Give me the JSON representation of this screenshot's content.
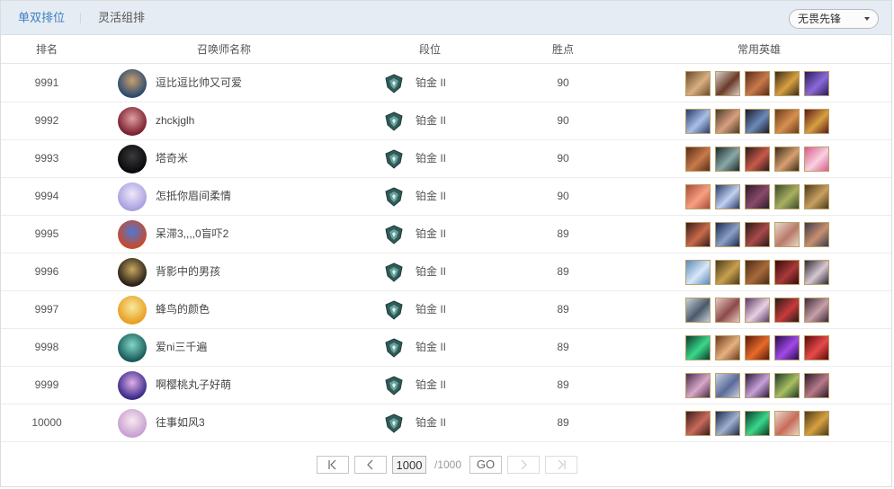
{
  "tabs": [
    {
      "label": "单双排位",
      "active": true
    },
    {
      "label": "灵活组排",
      "active": false
    }
  ],
  "filter": {
    "selected": "无畏先锋"
  },
  "columns": {
    "rank": "排名",
    "name": "召唤师名称",
    "tier": "段位",
    "lp": "胜点",
    "heroes": "常用英雄"
  },
  "rows": [
    {
      "rank": "9991",
      "name": "逗比逗比帅又可爱",
      "tier": "铂金 II",
      "lp": "90",
      "avatar": [
        "#2c4a6e",
        "#c8a070"
      ],
      "heroes": [
        [
          "#6b4a2e",
          "#d8b080"
        ],
        [
          "#d8d0c8",
          "#6b3a2a"
        ],
        [
          "#5a2a1a",
          "#c87a4a"
        ],
        [
          "#3a2a1a",
          "#d8a040"
        ],
        [
          "#2a1a5a",
          "#8a6ad8"
        ]
      ]
    },
    {
      "rank": "9992",
      "name": "zhckjglh",
      "tier": "铂金 II",
      "lp": "90",
      "avatar": [
        "#7a2030",
        "#e0a0a0"
      ],
      "heroes": [
        [
          "#2a3a6a",
          "#a8c0e8"
        ],
        [
          "#4a3a2a",
          "#d8a080"
        ],
        [
          "#1a1a2a",
          "#6a8ab8"
        ],
        [
          "#6a3a1a",
          "#d89050"
        ],
        [
          "#5a1a1a",
          "#d8a040"
        ]
      ]
    },
    {
      "rank": "9993",
      "name": "塔奇米",
      "tier": "铂金 II",
      "lp": "90",
      "avatar": [
        "#0a0a0e",
        "#3a3a3a"
      ],
      "heroes": [
        [
          "#5a2a1a",
          "#c87a4a"
        ],
        [
          "#1a2a2a",
          "#8aa8a8"
        ],
        [
          "#2a1a1a",
          "#c85a4a"
        ],
        [
          "#3a2a1a",
          "#d8a070"
        ],
        [
          "#d85a8a",
          "#f8d0e0"
        ]
      ]
    },
    {
      "rank": "9994",
      "name": "怎抵你眉间柔情",
      "tier": "铂金 II",
      "lp": "90",
      "avatar": [
        "#a8a0e0",
        "#f0e8f8"
      ],
      "heroes": [
        [
          "#a84a3a",
          "#f8a080"
        ],
        [
          "#2a3a6a",
          "#c0d0f0"
        ],
        [
          "#2a1a2a",
          "#8a4a6a"
        ],
        [
          "#3a4a2a",
          "#a8b060"
        ],
        [
          "#4a3a1a",
          "#c8a060"
        ]
      ]
    },
    {
      "rank": "9995",
      "name": "呆滞3,,,,0盲吓2",
      "tier": "铂金 II",
      "lp": "89",
      "avatar": [
        "#c84a2a",
        "#4a7ad8"
      ],
      "heroes": [
        [
          "#3a1a1a",
          "#c86a4a"
        ],
        [
          "#1a2a4a",
          "#8aa0c8"
        ],
        [
          "#2a1a1a",
          "#a84a4a"
        ],
        [
          "#e8d8c8",
          "#b87a6a"
        ],
        [
          "#3a3a4a",
          "#c89070"
        ]
      ]
    },
    {
      "rank": "9996",
      "name": "背影中的男孩",
      "tier": "铂金 II",
      "lp": "89",
      "avatar": [
        "#2a2018",
        "#c8a860"
      ],
      "heroes": [
        [
          "#5a8ab8",
          "#d8e8f8"
        ],
        [
          "#4a3a1a",
          "#c8a050"
        ],
        [
          "#4a2a1a",
          "#a86a3a"
        ],
        [
          "#3a0a0a",
          "#a83a3a"
        ],
        [
          "#2a2a3a",
          "#d8c8d0"
        ]
      ]
    },
    {
      "rank": "9997",
      "name": "蜂鸟的颜色",
      "tier": "铂金 II",
      "lp": "89",
      "avatar": [
        "#e8a020",
        "#f8e8a0"
      ],
      "heroes": [
        [
          "#c8d0d8",
          "#4a5a6a"
        ],
        [
          "#e8c8c0",
          "#8a4a4a"
        ],
        [
          "#5a3a6a",
          "#e8d0e0"
        ],
        [
          "#2a1a1a",
          "#c83a3a"
        ],
        [
          "#3a2a3a",
          "#c8a0a8"
        ]
      ]
    },
    {
      "rank": "9998",
      "name": "爱ni三千遍",
      "tier": "铂金 II",
      "lp": "89",
      "avatar": [
        "#1a5a5a",
        "#80d8c8"
      ],
      "heroes": [
        [
          "#0a3a2a",
          "#3ad88a"
        ],
        [
          "#6a3a1a",
          "#e8b080"
        ],
        [
          "#5a1a0a",
          "#e86a2a"
        ],
        [
          "#2a0a4a",
          "#a04ae8"
        ],
        [
          "#5a0a0a",
          "#e84a4a"
        ]
      ]
    },
    {
      "rank": "9999",
      "name": "啊樱桃丸子好萌",
      "tier": "铂金 II",
      "lp": "89",
      "avatar": [
        "#3a2a8a",
        "#e0b0e8"
      ],
      "heroes": [
        [
          "#4a2a4a",
          "#d8a8c8"
        ],
        [
          "#c8d0e0",
          "#5a6a9a"
        ],
        [
          "#2a1a3a",
          "#c8a0d8"
        ],
        [
          "#1a3a2a",
          "#a8c060"
        ],
        [
          "#2a1a2a",
          "#b87a8a"
        ]
      ]
    },
    {
      "rank": "10000",
      "name": "往事如风3",
      "tier": "铂金 II",
      "lp": "89",
      "avatar": [
        "#c8a0d0",
        "#f8e8f0"
      ],
      "heroes": [
        [
          "#3a1a1a",
          "#c86a5a"
        ],
        [
          "#1a2a4a",
          "#a0b0d0"
        ],
        [
          "#0a3a2a",
          "#3ad88a"
        ],
        [
          "#e8d8c8",
          "#c86a5a"
        ],
        [
          "#4a3a1a",
          "#d8a040"
        ]
      ]
    }
  ],
  "pagination": {
    "first_icon": "first-page-icon",
    "prev_icon": "prev-page-icon",
    "current": "1000",
    "total": "/1000",
    "go_label": "GO",
    "next_icon": "next-page-icon",
    "last_icon": "last-page-icon"
  },
  "colors": {
    "accent": "#3a7fc1",
    "topbar_bg": "#e6ecf3",
    "tier_emblem": "#2f5c5a"
  }
}
